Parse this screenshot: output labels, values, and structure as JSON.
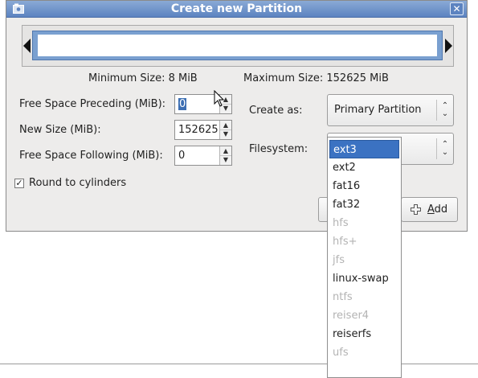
{
  "dialog": {
    "title": "Create new Partition",
    "close_glyph": "✕"
  },
  "info": {
    "min_size": "Minimum Size: 8 MiB",
    "max_size": "Maximum Size: 152625 MiB"
  },
  "fields": {
    "free_preceding": {
      "label": "Free Space Preceding (MiB):",
      "value": "0"
    },
    "new_size": {
      "label": "New Size (MiB):",
      "value": "152625"
    },
    "free_following": {
      "label": "Free Space Following (MiB):",
      "value": "0"
    }
  },
  "create_as": {
    "label": "Create as:",
    "value": "Primary Partition"
  },
  "filesystem": {
    "label": "Filesystem:",
    "options": [
      {
        "label": "ext3",
        "state": "selected"
      },
      {
        "label": "ext2",
        "state": "enabled"
      },
      {
        "label": "fat16",
        "state": "enabled"
      },
      {
        "label": "fat32",
        "state": "enabled"
      },
      {
        "label": "hfs",
        "state": "disabled"
      },
      {
        "label": "hfs+",
        "state": "disabled"
      },
      {
        "label": "jfs",
        "state": "disabled"
      },
      {
        "label": "linux-swap",
        "state": "enabled"
      },
      {
        "label": "ntfs",
        "state": "disabled"
      },
      {
        "label": "reiser4",
        "state": "disabled"
      },
      {
        "label": "reiserfs",
        "state": "enabled"
      },
      {
        "label": "ufs",
        "state": "disabled"
      }
    ]
  },
  "round_to_cylinders": {
    "label": "Round to cylinders",
    "checked": true,
    "mark": "✓"
  },
  "buttons": {
    "add_prefix": "",
    "add_mnemonic": "A",
    "add_rest": "dd"
  },
  "icons": {
    "spin_up": "▲",
    "spin_down": "▼",
    "combo_arrows": "⌃⌄"
  },
  "colors": {
    "titlebar": "#6a8fc8",
    "selection": "#3b72c2",
    "disabled_text": "#b3b3b3"
  }
}
